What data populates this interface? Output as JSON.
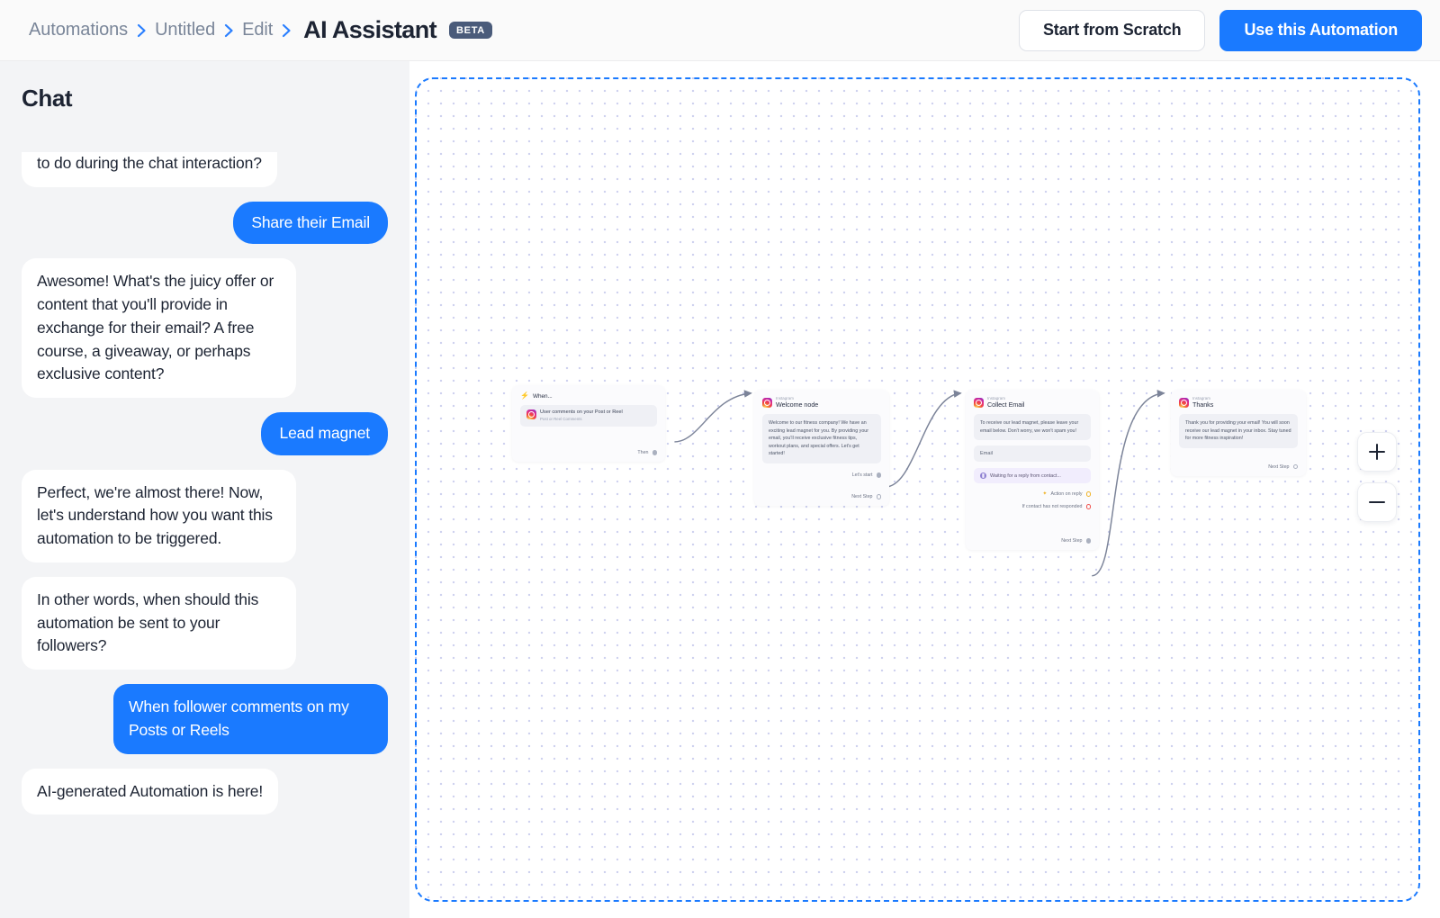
{
  "header": {
    "breadcrumb": [
      {
        "label": "Automations"
      },
      {
        "label": "Untitled"
      },
      {
        "label": "Edit"
      }
    ],
    "page_title": "AI Assistant",
    "badge": "BETA",
    "buttons": {
      "secondary": "Start from Scratch",
      "primary": "Use this Automation"
    },
    "colors": {
      "primary": "#1a7aff",
      "badge_bg": "#4a5b7a",
      "crumb": "#7a8699"
    }
  },
  "chat": {
    "title": "Chat",
    "messages": [
      {
        "role": "bot",
        "text": "to do during the chat interaction?",
        "clipped": true
      },
      {
        "role": "user",
        "text": "Share their Email",
        "pill": true
      },
      {
        "role": "bot",
        "text": "Awesome! What's the juicy offer or content that you'll provide in exchange for their email? A free course, a giveaway, or perhaps exclusive content?"
      },
      {
        "role": "user",
        "text": "Lead magnet",
        "pill": true
      },
      {
        "role": "bot",
        "text": "Perfect, we're almost there! Now, let's understand how you want this automation to be triggered."
      },
      {
        "role": "bot",
        "text": "In other words, when should this automation be sent to your followers?"
      },
      {
        "role": "user",
        "text": "When follower comments on my Posts or Reels"
      },
      {
        "role": "bot",
        "text": "AI-generated Automation is here!"
      }
    ]
  },
  "canvas": {
    "zoom_in_label": "+",
    "zoom_out_label": "−",
    "nodes": {
      "trigger": {
        "header_label": "When...",
        "item_title": "User comments on your Post or Reel",
        "item_subtitle": "Post or Reel Comments",
        "out_label": "Then"
      },
      "welcome": {
        "platform": "Instagram",
        "title": "Welcome node",
        "message": "Welcome to our fitness company! We have an exciting lead magnet for you. By providing your email, you'll receive exclusive fitness tips, workout plans, and special offers. Let's get started!",
        "button_label": "Let's start",
        "next_label": "Next Step"
      },
      "collect_email": {
        "platform": "Instagram",
        "title": "Collect Email",
        "message": "To receive our lead magnet, please leave your email below. Don't worry, we won't spam you!",
        "input_placeholder": "Email",
        "waiting_label": "Waiting for a reply from contact...",
        "action_on_reply_label": "Action on reply",
        "not_responded_label": "If contact has not responded",
        "next_label": "Next Step"
      },
      "thanks": {
        "platform": "Instagram",
        "title": "Thanks",
        "message": "Thank you for providing your email! You will soon receive our lead magnet in your inbox. Stay tuned for more fitness inspiration!",
        "next_label": "Next Step"
      }
    }
  }
}
